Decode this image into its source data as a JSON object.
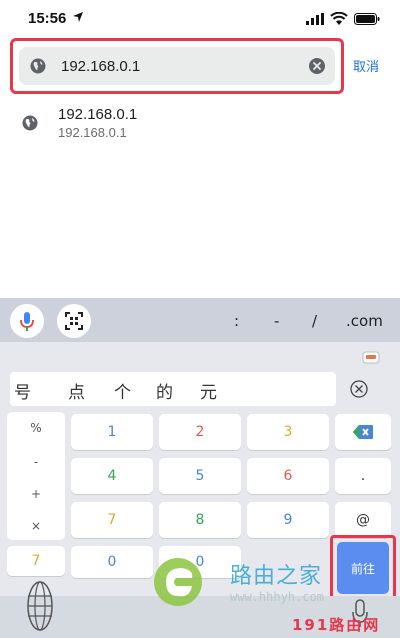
{
  "status_bar": {
    "time": "15:56",
    "icons": [
      "location-arrow-icon",
      "signal-icon",
      "wifi-icon",
      "battery-icon"
    ]
  },
  "address_bar": {
    "value": "192.168.0.1",
    "clear_icon": "clear-circle-icon",
    "globe_icon": "globe-icon"
  },
  "cancel_label": "取消",
  "suggestion": {
    "title": "192.168.0.1",
    "subtitle": "192.168.0.1"
  },
  "keyboard": {
    "toolbar": {
      "mic_icon": "mic-icon",
      "scan_icon": "scan-icon",
      "symbols": [
        ":",
        "-",
        "/",
        ".com"
      ]
    },
    "candidates": [
      "号",
      "点",
      "个",
      "的",
      "元"
    ],
    "side_keys": [
      "%",
      "-",
      "+",
      "×",
      "7"
    ],
    "number_rows": [
      [
        "1",
        "2",
        "3"
      ],
      [
        "4",
        "5",
        "6"
      ],
      [
        "7",
        "8",
        "9"
      ],
      [
        "0",
        "0"
      ]
    ],
    "right_keys": [
      ".",
      "@"
    ],
    "go_label": "前往",
    "colors": {
      "k1": "#4a86d6",
      "k2": "#e05a4f",
      "k3": "#e3a72f",
      "k4": "#34a853",
      "k5": "#4a86d6",
      "k6": "#e05a4f",
      "k7": "#e3a72f",
      "k8": "#34a853",
      "k9": "#4a86d6",
      "k0": "#4a86d6",
      "go": "#5b8df0"
    }
  },
  "watermark": {
    "brand": "路由之家",
    "url": "www.hhhyh.com",
    "badge": "191路由网"
  }
}
